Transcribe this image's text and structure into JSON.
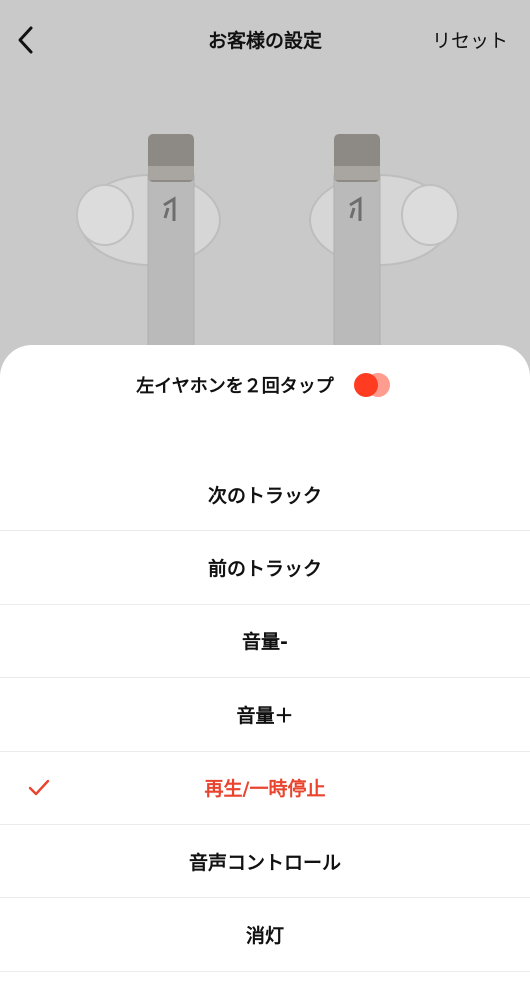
{
  "header": {
    "back_icon": "chevron-left-icon",
    "title": "お客様の設定",
    "reset_label": "リセット"
  },
  "sheet": {
    "title": "左イヤホンを２回タップ",
    "toggle_icon": "dots-toggle-icon",
    "accent_color": "#e8442e",
    "options": [
      {
        "label": "次のトラック",
        "selected": false
      },
      {
        "label": "前のトラック",
        "selected": false
      },
      {
        "label": "音量-",
        "selected": false
      },
      {
        "label": "音量＋",
        "selected": false
      },
      {
        "label": "再生/一時停止",
        "selected": true
      },
      {
        "label": "音声コントロール",
        "selected": false
      },
      {
        "label": "消灯",
        "selected": false
      }
    ]
  }
}
